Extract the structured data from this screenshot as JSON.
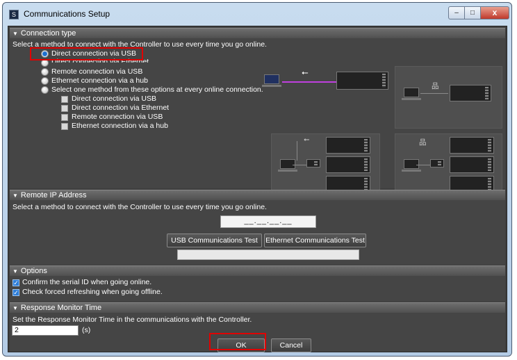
{
  "window": {
    "title": "Communications Setup",
    "controls": {
      "minimize": "–",
      "maximize": "□",
      "close": "x"
    }
  },
  "connection_type": {
    "header": "Connection type",
    "instruction": "Select a method to connect with the Controller to use every time you go online.",
    "options": [
      {
        "label": "Direct connection via USB",
        "selected": true
      },
      {
        "label": "Direct connection via Ethernet",
        "selected": false
      },
      {
        "label": "Remote connection via USB",
        "selected": false
      },
      {
        "label": "Ethernet connection via a hub",
        "selected": false
      },
      {
        "label": "Select one method from these options at every online connection.",
        "selected": false
      }
    ],
    "sub_options": [
      {
        "label": "Direct connection via USB",
        "checked": false
      },
      {
        "label": "Direct connection via Ethernet",
        "checked": false
      },
      {
        "label": "Remote connection via USB",
        "checked": false
      },
      {
        "label": "Ethernet connection via a hub",
        "checked": false
      }
    ]
  },
  "remote_ip": {
    "header": "Remote IP Address",
    "instruction": "Select a method to connect with the Controller to use every time you go online.",
    "ip_value": "__.__.__.__",
    "usb_test_label": "USB Communications Test",
    "ethernet_test_label": "Ethernet Communications Test"
  },
  "options": {
    "header": "Options",
    "items": [
      {
        "label": "Confirm the serial ID when going online.",
        "checked": true
      },
      {
        "label": "Check forced refreshing when going offline.",
        "checked": true
      }
    ]
  },
  "response_monitor": {
    "header": "Response Monitor Time",
    "instruction": "Set the Response Monitor Time in the communications with the Controller.",
    "value": "2",
    "unit": "(s)"
  },
  "footer": {
    "ok_label": "OK",
    "cancel_label": "Cancel"
  },
  "icons": {
    "usb": "usb-icon",
    "network": "network-icon"
  },
  "colors": {
    "highlight": "#e00000",
    "selected_radio": "#1e6fd0",
    "link_line": "#c040e0"
  }
}
